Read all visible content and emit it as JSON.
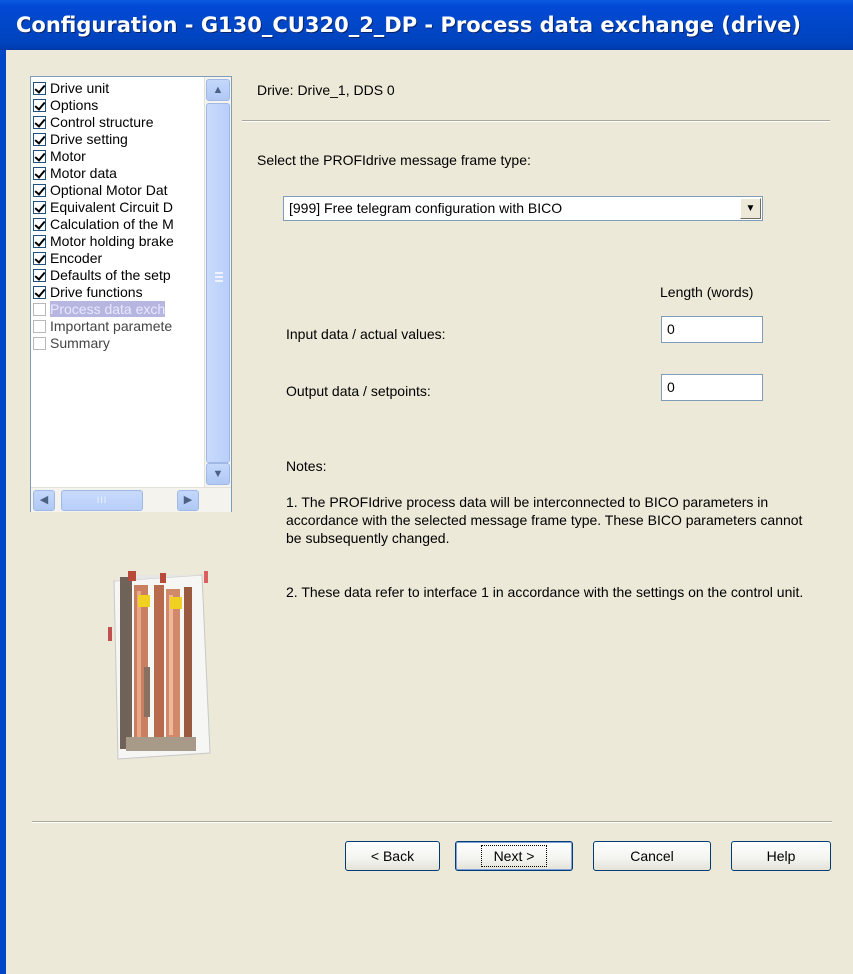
{
  "window": {
    "title": "Configuration - G130_CU320_2_DP - Process data exchange (drive)"
  },
  "sidebar": {
    "items": [
      {
        "label": "Drive unit",
        "checked": true
      },
      {
        "label": "Options",
        "checked": true
      },
      {
        "label": "Control structure",
        "checked": true
      },
      {
        "label": "Drive setting",
        "checked": true
      },
      {
        "label": "Motor",
        "checked": true
      },
      {
        "label": "Motor data",
        "checked": true
      },
      {
        "label": "Optional Motor Dat",
        "checked": true
      },
      {
        "label": "Equivalent Circuit D",
        "checked": true
      },
      {
        "label": "Calculation of the M",
        "checked": true
      },
      {
        "label": "Motor holding brake",
        "checked": true
      },
      {
        "label": "Encoder",
        "checked": true
      },
      {
        "label": "Defaults of the setp",
        "checked": true
      },
      {
        "label": "Drive functions",
        "checked": true
      },
      {
        "label": "Process data exch",
        "checked": false,
        "selected": true
      },
      {
        "label": "Important paramete",
        "checked": false
      },
      {
        "label": "Summary",
        "checked": false
      }
    ]
  },
  "main": {
    "drive_label": "Drive: Drive_1, DDS 0",
    "select_label": "Select the PROFIdrive message frame type:",
    "telegram_selected": "[999] Free telegram configuration with BICO",
    "length_header": "Length (words)",
    "input_label": "Input data / actual values:",
    "input_value": "0",
    "output_label": "Output data / setpoints:",
    "output_value": "0",
    "notes_title": "Notes:",
    "note1": "1. The PROFIdrive process data will be interconnected to BICO parameters in accordance with the selected message frame type. These BICO parameters cannot be subsequently changed.",
    "note2": "2. These data refer to interface 1 in accordance with the settings on the control unit."
  },
  "buttons": {
    "back": "< Back",
    "next": "Next >",
    "cancel": "Cancel",
    "help": "Help"
  },
  "icons": {
    "scroll_up": "▲",
    "scroll_down": "▼",
    "scroll_left": "◀",
    "scroll_right": "▶",
    "combo_arrow": "▼",
    "hthumb_grip": "III"
  }
}
